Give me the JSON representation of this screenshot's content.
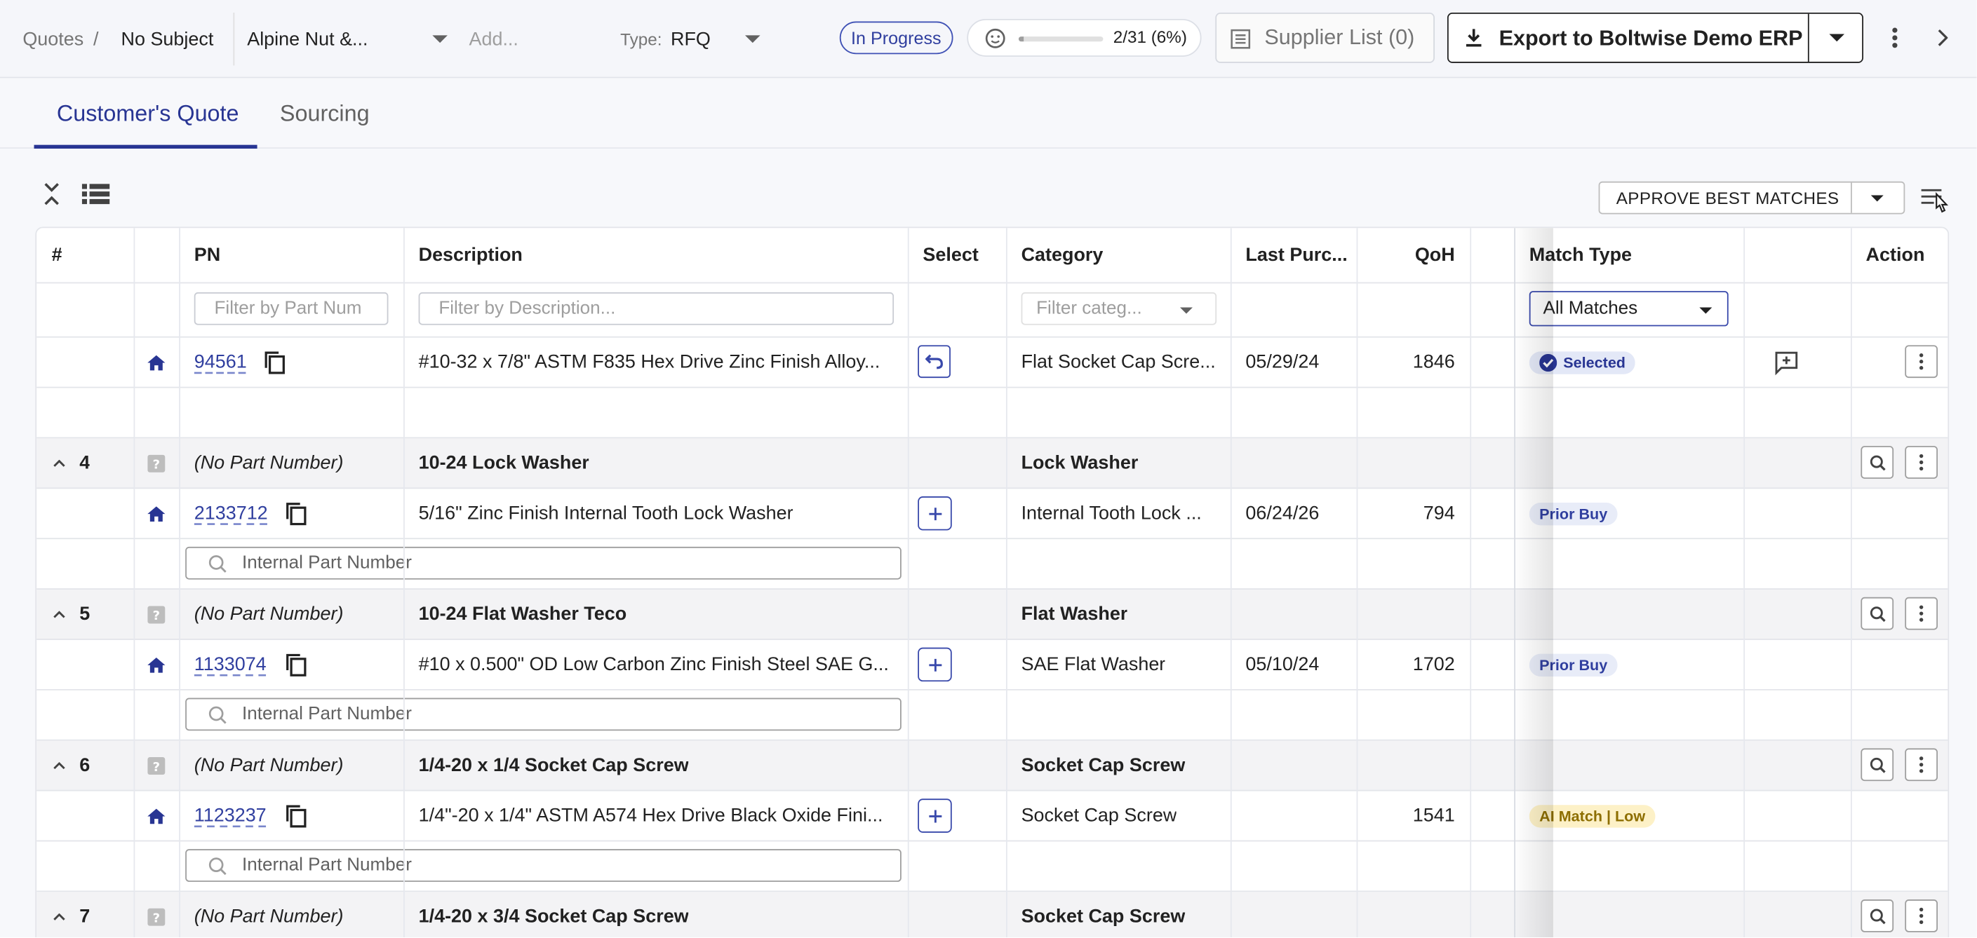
{
  "topbar": {
    "breadcrumb_root": "Quotes",
    "breadcrumb_sep": "/",
    "breadcrumb_current": "No Subject",
    "customer": "Alpine Nut &...",
    "add_placeholder": "Add...",
    "type_label": "Type:",
    "type_value": "RFQ",
    "status": "In Progress",
    "progress_text": "2/31 (6%)",
    "progress_fraction": 0.06,
    "supplier_list": "Supplier List (0)",
    "export_label": "Export to Boltwise Demo ERP"
  },
  "tabs": [
    {
      "label": "Customer's Quote",
      "active": true
    },
    {
      "label": "Sourcing",
      "active": false
    }
  ],
  "toolbar": {
    "approve_label": "APPROVE BEST MATCHES"
  },
  "table": {
    "headers": {
      "num": "#",
      "pn": "PN",
      "description": "Description",
      "select": "Select",
      "category": "Category",
      "last_purchase": "Last Purc...",
      "qoh": "QoH",
      "match_type": "Match Type",
      "action": "Action"
    },
    "filters": {
      "pn_placeholder": "Filter by Part Num",
      "desc_placeholder": "Filter by Description...",
      "category_placeholder": "Filter categ...",
      "match_value": "All Matches"
    },
    "row1": {
      "pn": "94561",
      "description": "#10-32 x 7/8\" ASTM F835 Hex Drive Zinc Finish Alloy...",
      "category": "Flat Socket Cap Scre...",
      "last_purchase": "05/29/24",
      "qoh": "1846",
      "match": "Selected"
    },
    "groups": [
      {
        "num": "4",
        "pn": "(No Part Number)",
        "description": "10-24 Lock Washer",
        "category": "Lock Washer",
        "item": {
          "pn": "2133712",
          "description": "5/16\" Zinc Finish Internal Tooth Lock Washer",
          "category": "Internal Tooth Lock ...",
          "last_purchase": "06/24/26",
          "qoh": "794",
          "match": "Prior Buy"
        },
        "search_placeholder": "Internal Part Number"
      },
      {
        "num": "5",
        "pn": "(No Part Number)",
        "description": "10-24 Flat Washer Teco",
        "category": "Flat Washer",
        "item": {
          "pn": "1133074",
          "description": "#10 x 0.500\" OD Low Carbon Zinc Finish Steel SAE G...",
          "category": "SAE Flat Washer",
          "last_purchase": "05/10/24",
          "qoh": "1702",
          "match": "Prior Buy"
        },
        "search_placeholder": "Internal Part Number"
      },
      {
        "num": "6",
        "pn": "(No Part Number)",
        "description": "1/4-20 x 1/4 Socket Cap Screw",
        "category": "Socket Cap Screw",
        "item": {
          "pn": "1123237",
          "description": "1/4\"-20 x 1/4\" ASTM A574 Hex Drive Black Oxide Fini...",
          "category": "Socket Cap Screw",
          "last_purchase": "",
          "qoh": "1541",
          "match": "AI Match | Low"
        },
        "search_placeholder": "Internal Part Number"
      }
    ],
    "last_group": {
      "num": "7",
      "pn": "(No Part Number)",
      "description": "1/4-20 x 3/4 Socket Cap Screw",
      "category": "Socket Cap Screw"
    }
  },
  "colors": {
    "accent": "#283593",
    "link": "#303f9f",
    "ai_badge": "#fdf1c7",
    "prior_badge": "#e8ecf8"
  }
}
